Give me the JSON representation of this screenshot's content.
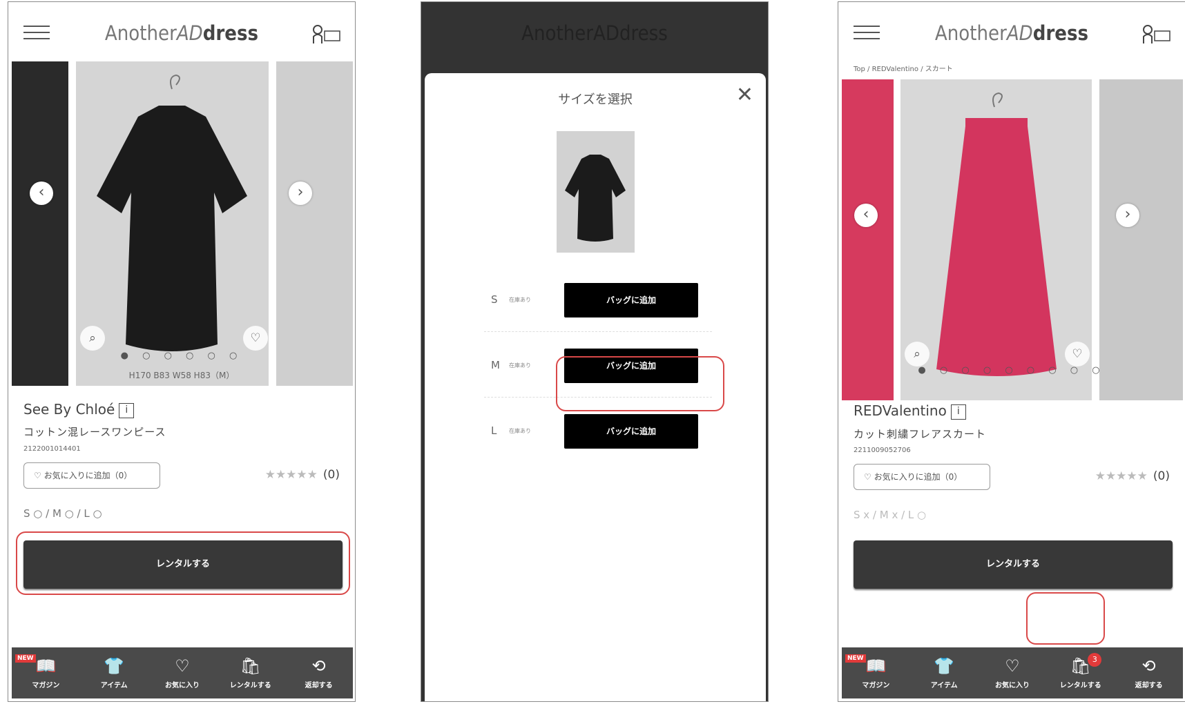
{
  "colors": {
    "accent_red": "#d94848",
    "button_dark": "#383838",
    "nav_bg": "#4a4a4a",
    "badge_red": "#e23a3a"
  },
  "header": {
    "logo_part1": "Another",
    "logo_part2": "AD",
    "logo_part3": "dress"
  },
  "screen1": {
    "measurements": "H170 B83 W58 H83（M）",
    "brand": "See By Chloé",
    "product_name": "コットン混レースワンピース",
    "sku": "2122001014401",
    "fav_button": "♡ お気に入りに追加（0）",
    "rating_stars": "★★★★★",
    "rating_count": "(0)",
    "sizes": "S ○ / M ○ / L ○",
    "rent_button": "レンタルする",
    "dots": "● ○ ○ ○ ○ ○"
  },
  "screen2": {
    "title": "サイズを選択",
    "rows": [
      {
        "size": "S",
        "stock": "在庫あり",
        "button": "バッグに追加"
      },
      {
        "size": "M",
        "stock": "在庫あり",
        "button": "バッグに追加"
      },
      {
        "size": "L",
        "stock": "在庫あり",
        "button": "バッグに追加"
      }
    ]
  },
  "screen3": {
    "breadcrumb": "Top / REDValentino / スカート",
    "brand": "REDValentino",
    "product_name": "カット刺繍フレアスカート",
    "sku": "2211009052706",
    "fav_button": "♡ お気に入りに追加（0）",
    "rating_stars": "★★★★★",
    "rating_count": "(0)",
    "sizes": "S x / M x / L ○",
    "rent_button": "レンタルする",
    "dots": "● ○ ○ ○ ○ ○ ○ ○ ○",
    "cart_badge": "3"
  },
  "nav": {
    "new_tag": "NEW",
    "items": [
      {
        "label": "マガジン",
        "icon": "magazine-icon"
      },
      {
        "label": "アイテム",
        "icon": "tshirt-icon"
      },
      {
        "label": "お気に入り",
        "icon": "heart-icon"
      },
      {
        "label": "レンタルする",
        "icon": "bag-icon"
      },
      {
        "label": "返却する",
        "icon": "return-icon"
      }
    ]
  }
}
